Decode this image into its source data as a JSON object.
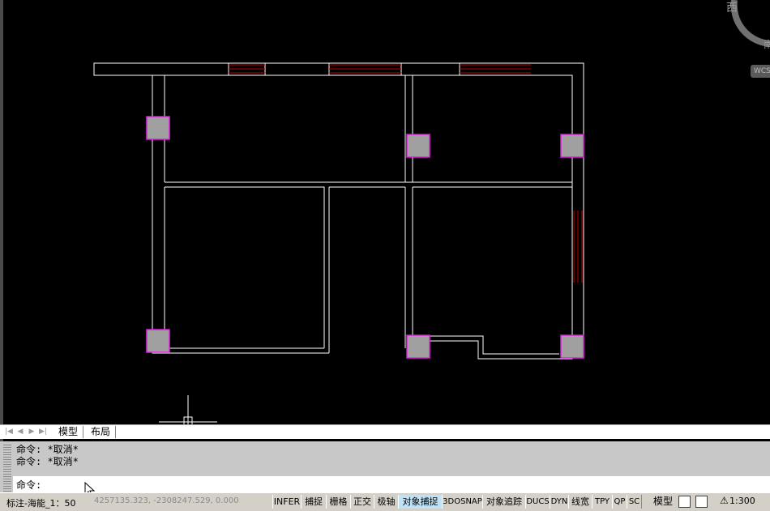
{
  "viewcube": {
    "west": "西",
    "south": "南",
    "wcs_label": "WCS"
  },
  "tabs": {
    "model": "模型",
    "layout": "布局"
  },
  "command": {
    "history": [
      "命令: *取消*",
      "命令: *取消*"
    ],
    "prompt": "命令:"
  },
  "status": {
    "annotation_scale": "标注-海能_1：50",
    "coordinates": "4257135.323, -2308247.529, 0.000",
    "toggles": [
      {
        "label": "INFER",
        "on": false
      },
      {
        "label": "捕捉",
        "on": false
      },
      {
        "label": "栅格",
        "on": false
      },
      {
        "label": "正交",
        "on": false
      },
      {
        "label": "极轴",
        "on": false
      },
      {
        "label": "对象捕捉",
        "on": true
      },
      {
        "label": "3DOSNAP",
        "on": false
      },
      {
        "label": "对象追踪",
        "on": false
      },
      {
        "label": "DUCS",
        "on": false
      },
      {
        "label": "DYN",
        "on": false
      },
      {
        "label": "线宽",
        "on": false
      },
      {
        "label": "TPY",
        "on": false
      },
      {
        "label": "QP",
        "on": false
      },
      {
        "label": "SC",
        "on": false
      }
    ],
    "model_space": "模型",
    "view_scale": "1:300"
  },
  "colors": {
    "wall": "#ffffff",
    "window": "#c00000",
    "column_fill": "#a0a0a0",
    "column_edge": "#e020e0",
    "toggle_on": "#bfe3f5"
  }
}
